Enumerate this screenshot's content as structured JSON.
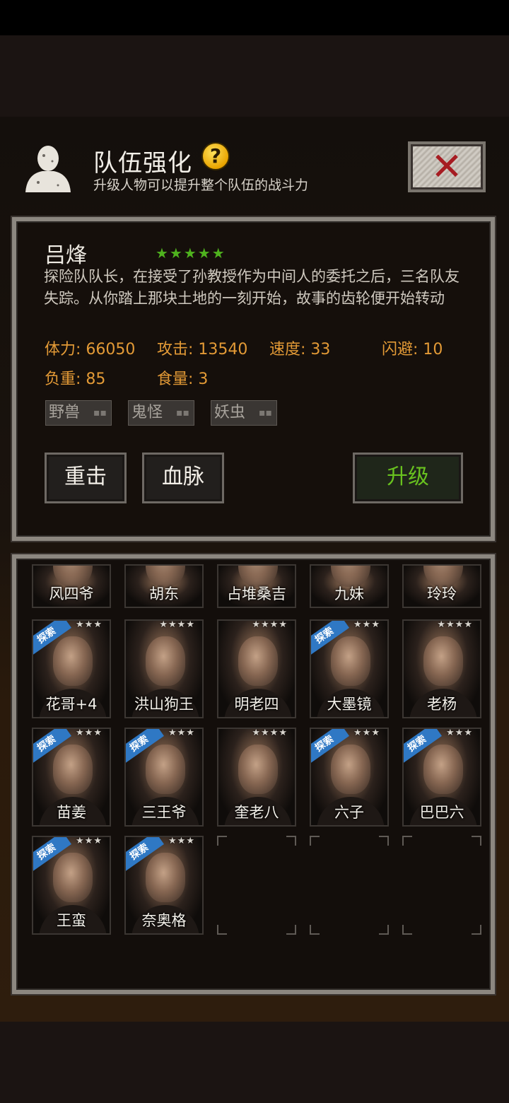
{
  "header": {
    "title": "队伍强化",
    "help_label": "?",
    "subtitle": "升级人物可以提升整个队伍的战斗力",
    "close_icon": "close-x-icon"
  },
  "hero": {
    "name": "吕烽",
    "stars": "★★★★★",
    "star_count": 5,
    "description": "探险队队长，在接受了孙教授作为中间人的委托之后，三名队友失踪。从你踏上那块土地的一刻开始，故事的齿轮便开始转动",
    "stats": {
      "hp": "体力: 66050",
      "attack": "攻击: 13540",
      "speed": "速度: 33",
      "dodge": "闪避: 10",
      "load": "负重: 85",
      "food": "食量: 3"
    },
    "tags": [
      "野兽",
      "鬼怪",
      "妖虫"
    ],
    "tag_dots": "▪▪",
    "skills": {
      "heavy_strike": "重击",
      "bloodline": "血脉",
      "upgrade": "升级"
    }
  },
  "roster": {
    "row1": [
      "风四爷",
      "胡东",
      "占堆桑吉",
      "九妹",
      "玲玲"
    ],
    "row2": [
      "花哥+4",
      "洪山狗王",
      "明老四",
      "大墨镜",
      "老杨"
    ],
    "row3": [
      "苗姜",
      "三王爷",
      "奎老八",
      "六子",
      "巴巴六"
    ],
    "row4": [
      "王蛮",
      "奈奥格"
    ],
    "explore_badge": "探索",
    "stars3": "★★★",
    "stars4": "★★★★"
  },
  "colors": {
    "accent_orange": "#e39a36",
    "upgrade_green": "#69c21f",
    "star_green": "#4fb21e",
    "explore_blue": "#2f78c4",
    "close_red": "#a61c22"
  }
}
